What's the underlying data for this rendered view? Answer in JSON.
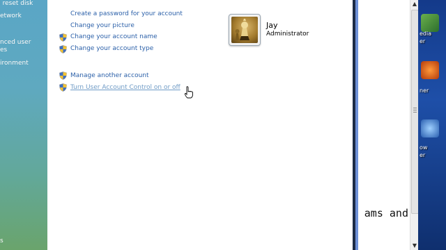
{
  "left_nav": {
    "items": [
      {
        "label": "ord reset disk"
      },
      {
        "label": "etwork"
      },
      {
        "label": "nced user"
      },
      {
        "label": "es"
      },
      {
        "label": "ironment"
      },
      {
        "label": "s"
      }
    ]
  },
  "tasks": {
    "create_password": "Create a password for your account",
    "change_picture": "Change your picture",
    "change_name": "Change your account name",
    "change_type": "Change your account type",
    "manage_another": "Manage another account",
    "turn_uac": "Turn User Account Control on or off"
  },
  "account": {
    "name": "Jay",
    "role": "Administrator"
  },
  "background_window": {
    "text": "ams and"
  },
  "desktop": {
    "labels": [
      "edia",
      "er",
      "ner",
      "ow",
      "er"
    ]
  },
  "colors": {
    "link": "#2a5fa8",
    "link_hover": "#6f9bc6",
    "window_border": "#6d8fd6"
  }
}
